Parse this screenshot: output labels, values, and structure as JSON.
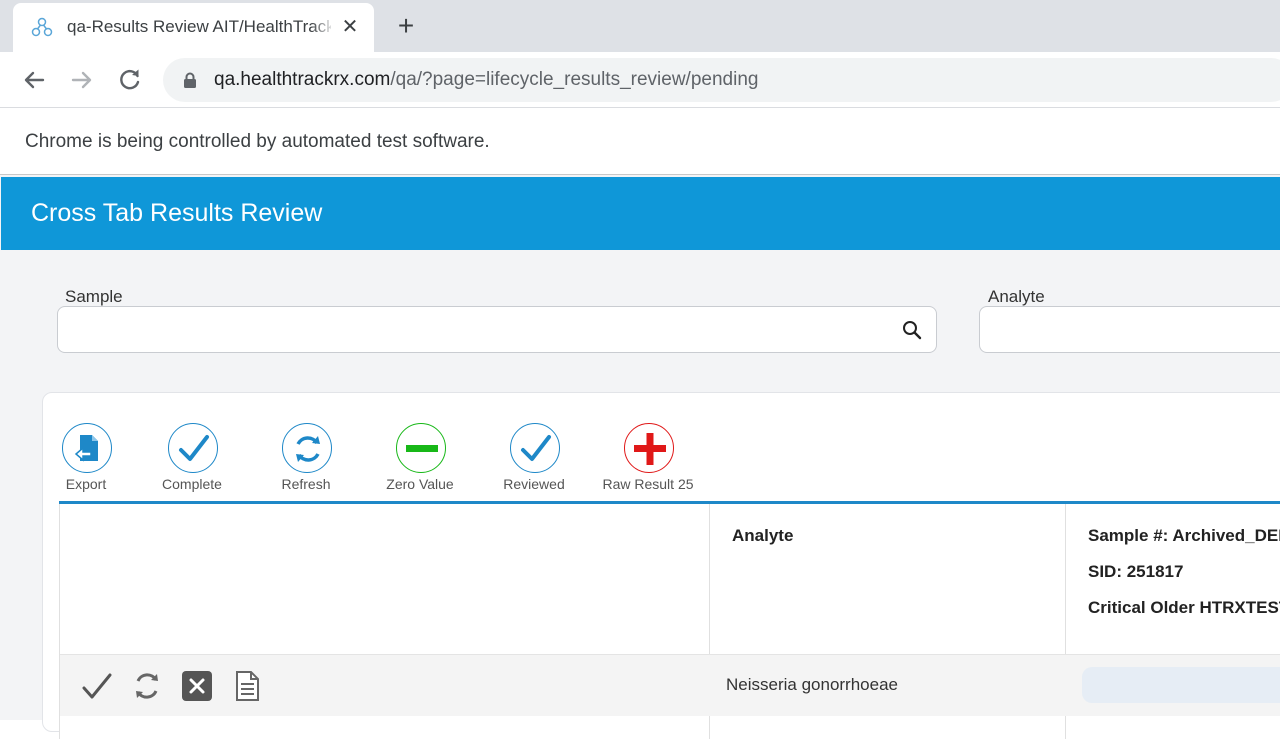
{
  "browser": {
    "tab_title": "qa-Results Review AIT/HealthTrack",
    "url_host": "qa.healthtrackrx.com",
    "url_path": "/qa/?page=lifecycle_results_review/pending",
    "infobar_text": "Chrome is being controlled by automated test software."
  },
  "page": {
    "title": "Cross Tab Results Review",
    "sample_label": "Sample",
    "sample_value": "",
    "analyte_label": "Analyte",
    "analyte_value": ""
  },
  "actions": [
    {
      "label": "Export",
      "icon": "export-icon",
      "color": "#1e88c8"
    },
    {
      "label": "Complete",
      "icon": "checkmark-icon",
      "color": "#1e88c8"
    },
    {
      "label": "Refresh",
      "icon": "refresh-icon",
      "color": "#1e88c8"
    },
    {
      "label": "Zero Value",
      "icon": "minus-icon",
      "color": "#18b818"
    },
    {
      "label": "Reviewed",
      "icon": "checkmark-icon",
      "color": "#1e88c8"
    },
    {
      "label": "Raw Result 25",
      "icon": "plus-icon",
      "color": "#e01818"
    }
  ],
  "grid": {
    "analyte_header": "Analyte",
    "sample_header_line1": "Sample #: Archived_DEMO",
    "sample_header_line2": "SID: 251817",
    "sample_header_line3": "Critical Older HTRXTEST",
    "rows": [
      {
        "analyte": "Neisseria gonorrhoeae"
      }
    ]
  },
  "colors": {
    "header_blue": "#0f97d8",
    "accent_blue": "#1e88c8"
  }
}
